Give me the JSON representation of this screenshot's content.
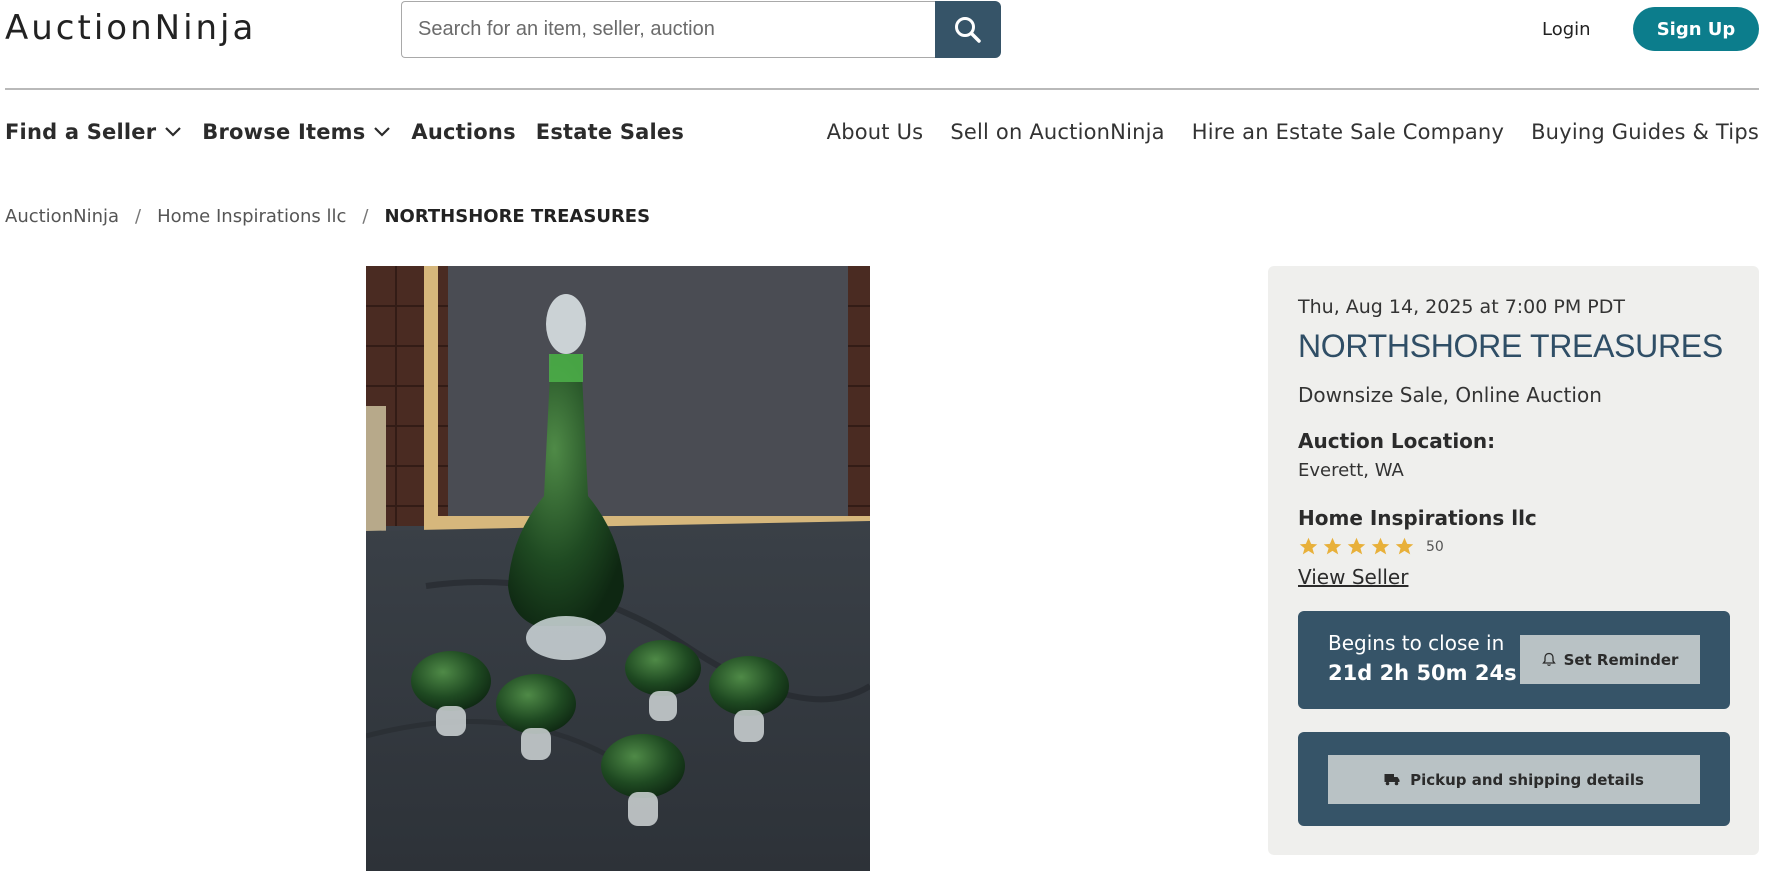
{
  "header": {
    "logo_text": "AuctionNinja",
    "search_placeholder": "Search for an item, seller, auction",
    "login_label": "Login",
    "signup_label": "Sign Up"
  },
  "nav": {
    "left": [
      {
        "label": "Find a Seller",
        "has_dropdown": true
      },
      {
        "label": "Browse Items",
        "has_dropdown": true
      },
      {
        "label": "Auctions",
        "has_dropdown": false
      },
      {
        "label": "Estate Sales",
        "has_dropdown": false
      }
    ],
    "right": [
      {
        "label": "About Us"
      },
      {
        "label": "Sell on AuctionNinja"
      },
      {
        "label": "Hire an Estate Sale Company"
      },
      {
        "label": "Buying Guides & Tips"
      }
    ]
  },
  "breadcrumb": {
    "items": [
      "AuctionNinja",
      "Home Inspirations llc",
      "NORTHSHORE TREASURES"
    ],
    "separator": "/"
  },
  "auction": {
    "date": "Thu, Aug 14, 2025 at 7:00 PM PDT",
    "title": "NORTHSHORE TREASURES",
    "sale_type": "Downsize Sale, Online Auction",
    "location_label": "Auction Location:",
    "location": "Everett, WA",
    "seller_name": "Home Inspirations llc",
    "rating_stars": 5,
    "rating_count": "50",
    "view_seller_label": "View Seller",
    "close_label": "Begins to close in",
    "close_countdown": "21d 2h 50m 24s",
    "reminder_label": "Set Reminder",
    "shipping_label": "Pickup and shipping details"
  },
  "colors": {
    "primary_dark": "#365468",
    "signup_teal": "#0c7d8c",
    "title_blue": "#2f4e66",
    "star_gold": "#e8b03a",
    "panel_bg": "#efefed",
    "button_gray": "#b9c2c5"
  },
  "icons": {
    "search": "search-icon",
    "dropdown": "chevron-down-icon",
    "reminder": "bell-icon",
    "shipping": "truck-icon",
    "star": "star-icon"
  }
}
